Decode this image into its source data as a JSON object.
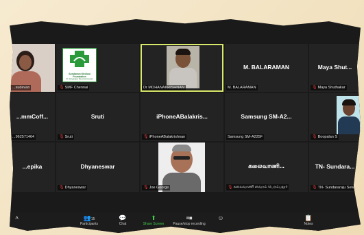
{
  "tiles": [
    {
      "name": "Sudevan",
      "label": "...sudevan",
      "muted": false,
      "kind": "photo-woman"
    },
    {
      "name": "SMF Chennai",
      "label": "SMF Chennai",
      "muted": true,
      "kind": "logo",
      "logo_text": "Sundaram Medical Foundation",
      "logo_sub": "Dr. Rangarajan Memorial Hospital"
    },
    {
      "name": "Dr MOHANAKRISHNAN",
      "label": "Dr MOHANAKRISHNAN",
      "muted": false,
      "kind": "video",
      "active": true
    },
    {
      "name": "M. BALARAMAN",
      "label": "M. BALARAMAN",
      "muted": false,
      "kind": "text"
    },
    {
      "name": "Maya Shut...",
      "label": "Maya Shuthakar",
      "muted": true,
      "kind": "text"
    },
    {
      "name": "...mmCoff...",
      "label": "...962571464",
      "muted": false,
      "kind": "text"
    },
    {
      "name": "Sruti",
      "label": "Sruti",
      "muted": true,
      "kind": "text"
    },
    {
      "name": "iPhoneABalakris...",
      "label": "iPhoneABalakrishnan",
      "muted": true,
      "kind": "text"
    },
    {
      "name": "Samsung  SM-A2...",
      "label": "Samsung SM-A225F",
      "muted": false,
      "kind": "text"
    },
    {
      "name": "Boopalan S",
      "label": "Boopalan S",
      "muted": true,
      "kind": "photo-man"
    },
    {
      "name": "...epika",
      "label": "",
      "muted": false,
      "kind": "text"
    },
    {
      "name": "Dhyaneswar",
      "label": "Dhyaneswar",
      "muted": true,
      "kind": "text"
    },
    {
      "name": "Joe George",
      "label": "Joe George",
      "muted": true,
      "kind": "photo-joe"
    },
    {
      "name": "கலைவாணி...",
      "label": "கலைவாணி வைரம் பெரம்பதூர்",
      "muted": true,
      "kind": "text"
    },
    {
      "name": "TN-  Sundara...",
      "label": "TN- Sundararaju Selva...",
      "muted": true,
      "kind": "text"
    }
  ],
  "toolbar": {
    "participants_label": "Participants",
    "participants_count": "15",
    "chat_label": "Chat",
    "share_label": "Share Screen",
    "record_label": "Pause/stop recording",
    "notes_label": "Notes"
  },
  "colors": {
    "active_border": "#d9e86a",
    "share_green": "#3fcf4a",
    "muted_red": "#e23a3a",
    "tile_bg": "#232323"
  }
}
